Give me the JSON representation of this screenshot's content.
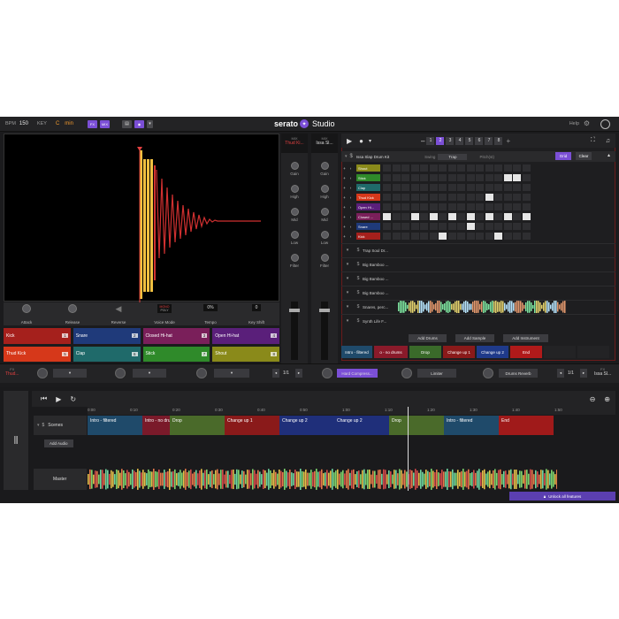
{
  "topbar": {
    "bpm_label": "BPM",
    "bpm_value": "150",
    "key_label": "KEY",
    "key_value": "C",
    "key_mode": "min",
    "fx_btn": "FX",
    "mix_btn": "MIX",
    "logo_a": "serato",
    "logo_b": "Studio",
    "help": "Help"
  },
  "sampler": {
    "controls": [
      "Attack",
      "Release",
      "Reverse",
      "Voice Mode",
      "Tempo",
      "Key Shift"
    ],
    "voice_mode_a": "MONO",
    "voice_mode_b": "POLY",
    "tempo_value": "0%",
    "key_shift_value": "0"
  },
  "pads": [
    {
      "label": "Kick",
      "num": "1",
      "color": "#a5201c"
    },
    {
      "label": "Snare",
      "num": "2",
      "color": "#1f3a7a"
    },
    {
      "label": "Closed Hi-hat",
      "num": "3",
      "color": "#7a1f5a"
    },
    {
      "label": "Open Hi-hat",
      "num": "4",
      "color": "#5a1f7a"
    },
    {
      "label": "Thud Kick",
      "num": "5",
      "color": "#d6381a"
    },
    {
      "label": "Clap",
      "num": "6",
      "color": "#1f6a6a"
    },
    {
      "label": "Stick",
      "num": "7",
      "color": "#2f8a2a"
    },
    {
      "label": "Shout",
      "num": "8",
      "color": "#8a8a1a"
    }
  ],
  "strips": {
    "a_label": "MIX",
    "a_name": "Thud Ki...",
    "b_label": "MIX",
    "b_name": "Issa Sl...",
    "knobs": [
      "Gain",
      "High",
      "Mid",
      "Low",
      "Filter"
    ]
  },
  "seq": {
    "patterns": [
      "1",
      "2",
      "3",
      "4",
      "5",
      "6",
      "7",
      "8"
    ],
    "active_pattern": "2",
    "kit_name": "Issa Slap Drum Kit",
    "swing_label": "Swing",
    "swing_value": "Trap",
    "pitch_label": "Pitch(st)",
    "grid_btn": "Grid",
    "clear_btn": "Clear",
    "drums": [
      {
        "label": "Shout",
        "color": "#8a8a1a",
        "steps": [
          0,
          0,
          0,
          0,
          0,
          0,
          0,
          0,
          0,
          0,
          0,
          0,
          0,
          0,
          0,
          0
        ]
      },
      {
        "label": "Stick",
        "color": "#2f8a2a",
        "steps": [
          0,
          0,
          0,
          0,
          0,
          0,
          0,
          0,
          0,
          0,
          0,
          0,
          0,
          1,
          1,
          0
        ]
      },
      {
        "label": "Clap",
        "color": "#1f6a6a",
        "steps": [
          0,
          0,
          0,
          0,
          0,
          0,
          0,
          0,
          0,
          0,
          0,
          0,
          0,
          0,
          0,
          0
        ]
      },
      {
        "label": "Thud Kick",
        "color": "#d6381a",
        "steps": [
          0,
          0,
          0,
          0,
          0,
          0,
          0,
          0,
          0,
          0,
          0,
          1,
          0,
          0,
          0,
          0
        ]
      },
      {
        "label": "Open Hi...",
        "color": "#5a1f7a",
        "steps": [
          0,
          0,
          0,
          0,
          0,
          0,
          0,
          0,
          0,
          0,
          0,
          0,
          0,
          0,
          0,
          0
        ]
      },
      {
        "label": "Closed ...",
        "color": "#7a1f5a",
        "steps": [
          1,
          0,
          0,
          1,
          0,
          1,
          0,
          1,
          0,
          1,
          0,
          1,
          0,
          1,
          0,
          1
        ]
      },
      {
        "label": "Snare",
        "color": "#1f3a7a",
        "steps": [
          0,
          0,
          0,
          0,
          0,
          0,
          0,
          0,
          0,
          1,
          0,
          0,
          0,
          0,
          0,
          0
        ]
      },
      {
        "label": "Kick",
        "color": "#a5201c",
        "steps": [
          0,
          0,
          0,
          0,
          0,
          0,
          1,
          0,
          0,
          0,
          0,
          0,
          1,
          0,
          0,
          0
        ]
      }
    ],
    "samples": [
      "Trap Soul Dr...",
      "Big Bamboo ...",
      "Big Bamboo ...",
      "Big Bamboo ...",
      "Snares, perc...",
      "Synth Life F..."
    ],
    "add_drums": "Add Drums",
    "add_sample": "Add Sample",
    "add_instrument": "Add Instrument"
  },
  "scene_bar": [
    {
      "label": "Intro - filtered",
      "color": "#1f4a6a"
    },
    {
      "label": "o - no drums",
      "color": "#8a1a2a"
    },
    {
      "label": "Drop",
      "color": "#3a6a2a"
    },
    {
      "label": "Change up 1",
      "color": "#8a1a1a"
    },
    {
      "label": "Change up 2",
      "color": "#1f3a8a"
    },
    {
      "label": "End",
      "color": "#b01a1a"
    }
  ],
  "fx": {
    "left_label": "FX",
    "left_name": "Thud...",
    "right_label": "FX",
    "right_name": "Issa Sl...",
    "slots": [
      "Hard Compress...",
      "Limiter",
      "Drums Reverb"
    ],
    "page": "1/1"
  },
  "arrange": {
    "ticks": [
      "0:00",
      "0:10",
      "0:20",
      "0:30",
      "0:40",
      "0:50",
      "1:00",
      "1:10",
      "1:20",
      "1:30",
      "1:40",
      "1:50"
    ],
    "scenes_label": "Scenes",
    "add_audio": "Add Audio",
    "master": "Master",
    "scenes": [
      {
        "label": "Intro - filtered",
        "color": "#1f4a6a",
        "w": 62
      },
      {
        "label": "Intro - no dru",
        "color": "#7a1a2a",
        "w": 31
      },
      {
        "label": "Drop",
        "color": "#4a6a2a",
        "w": 62
      },
      {
        "label": "Change up 1",
        "color": "#8a1a1a",
        "w": 62
      },
      {
        "label": "Change up 2",
        "color": "#1f2f7a",
        "w": 62
      },
      {
        "label": "Change up 2",
        "color": "#1f2f7a",
        "w": 62
      },
      {
        "label": "Drop",
        "color": "#4a6a2a",
        "w": 62
      },
      {
        "label": "Intro - filtered",
        "color": "#1f4a6a",
        "w": 62
      },
      {
        "label": "End",
        "color": "#a01a1a",
        "w": 62
      }
    ],
    "unlock": "Unlock all features"
  }
}
